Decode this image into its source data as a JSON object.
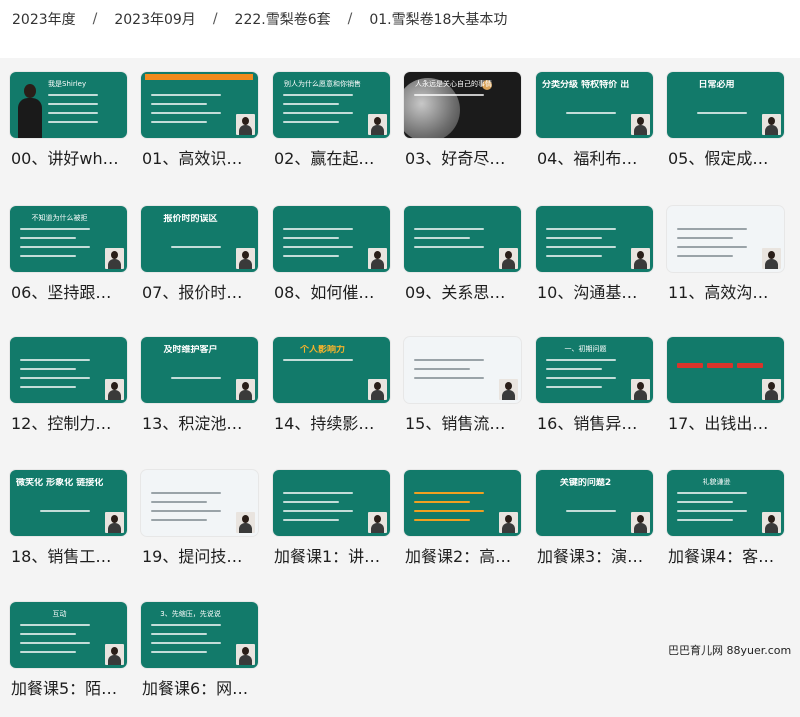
{
  "breadcrumb": [
    "2023年度",
    "2023年09月",
    "222.雪梨卷6套",
    "01.雪梨卷18大基本功"
  ],
  "breadcrumb_separator": "/",
  "watermark": "巴巴育儿网 88yuer.com",
  "colors": {
    "slide_teal": "#127a6a",
    "accent_orange": "#f08a1c",
    "panel_bg": "#f4f4f4"
  },
  "items": [
    {
      "label": "00、讲好wh…",
      "style": "intro",
      "slide_text": "我是Shirley"
    },
    {
      "label": "01、高效识…",
      "style": "table",
      "slide_text": ""
    },
    {
      "label": "02、赢在起…",
      "style": "list",
      "slide_text": "别人为什么愿意和你销售"
    },
    {
      "label": "03、好奇尽…",
      "style": "space",
      "slide_text": "人永远是关心自己的事情"
    },
    {
      "label": "04、福利布…",
      "style": "title",
      "slide_text": "分类分级  特权特价  出钱出力"
    },
    {
      "label": "05、假定成…",
      "style": "title",
      "slide_text": "日常必用"
    },
    {
      "label": "06、坚持跟…",
      "style": "list",
      "slide_text": "不知道为什么被拒"
    },
    {
      "label": "07、报价时…",
      "style": "title",
      "slide_text": "报价时的误区"
    },
    {
      "label": "08、如何催…",
      "style": "list",
      "slide_text": ""
    },
    {
      "label": "09、关系思…",
      "style": "diagram",
      "slide_text": ""
    },
    {
      "label": "10、沟通基…",
      "style": "list",
      "slide_text": ""
    },
    {
      "label": "11、高效沟…",
      "style": "doc",
      "slide_text": ""
    },
    {
      "label": "12、控制力…",
      "style": "list",
      "slide_text": ""
    },
    {
      "label": "13、积淀池…",
      "style": "title",
      "slide_text": "及时维护客户"
    },
    {
      "label": "14、持续影…",
      "style": "banner",
      "slide_text": "个人影响力"
    },
    {
      "label": "15、销售流…",
      "style": "screen",
      "slide_text": ""
    },
    {
      "label": "16、销售异…",
      "style": "list",
      "slide_text": "一、初期问题"
    },
    {
      "label": "17、出钱出…",
      "style": "flow",
      "slide_text": ""
    },
    {
      "label": "18、销售工…",
      "style": "title",
      "slide_text": "微笑化 形象化 链接化"
    },
    {
      "label": "19、提问技…",
      "style": "doc",
      "slide_text": ""
    },
    {
      "label": "加餐课1：讲…",
      "style": "list",
      "slide_text": ""
    },
    {
      "label": "加餐课2：高…",
      "style": "orangelist",
      "slide_text": ""
    },
    {
      "label": "加餐课3：演…",
      "style": "title",
      "slide_text": "关键的问题2"
    },
    {
      "label": "加餐课4：客…",
      "style": "list",
      "slide_text": "礼貌谦逊"
    },
    {
      "label": "加餐课5：陌…",
      "style": "list",
      "slide_text": "互动"
    },
    {
      "label": "加餐课6：网…",
      "style": "list",
      "slide_text": "3、先缩压，先说说"
    }
  ]
}
